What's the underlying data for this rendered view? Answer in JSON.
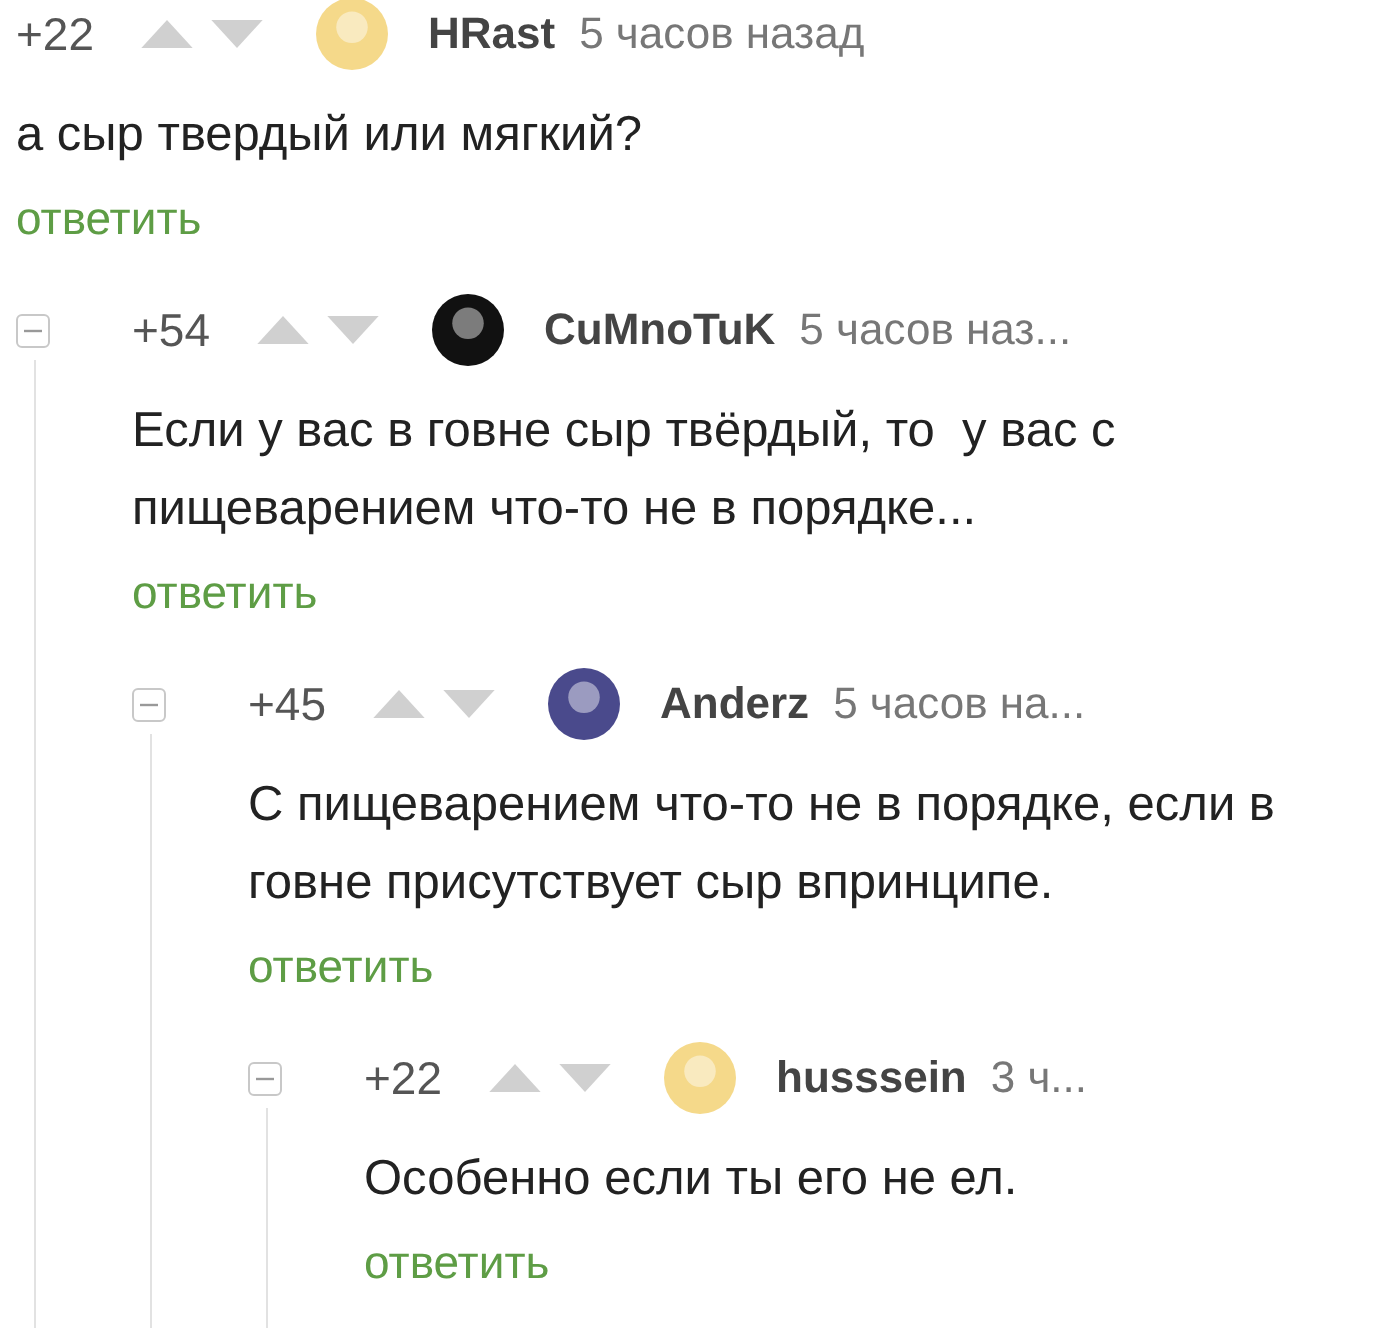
{
  "comments": [
    {
      "score": "+22",
      "author": "HRast",
      "time": "5 часов назад",
      "avatar": {
        "color": "#f5d98a"
      },
      "text": "а сыр твердый или мягкий?",
      "reply": "ответить",
      "children": [
        {
          "expanded": true,
          "score": "+54",
          "author": "CuMnoTuK",
          "time": "5 часов наз...",
          "avatar": {
            "color": "#111111"
          },
          "text": "Если у вас в говне сыр твёрдый, то  у вас с\nпищеварением что-то не в порядке...",
          "reply": "ответить",
          "children": [
            {
              "expanded": true,
              "score": "+45",
              "author": "Anderz",
              "time": "5 часов на...",
              "avatar": {
                "color": "#4a4a8c"
              },
              "text": "С пищеварением что-то не в порядке, если в\nговне присутствует сыр впринципе.",
              "reply": "ответить",
              "children": [
                {
                  "expanded": true,
                  "score": "+22",
                  "author": "husssein",
                  "time": "3 ч...",
                  "avatar": {
                    "color": "#f5d98a"
                  },
                  "text": "Особенно если ты его не ел.",
                  "reply": "ответить"
                }
              ]
            }
          ]
        }
      ]
    }
  ]
}
